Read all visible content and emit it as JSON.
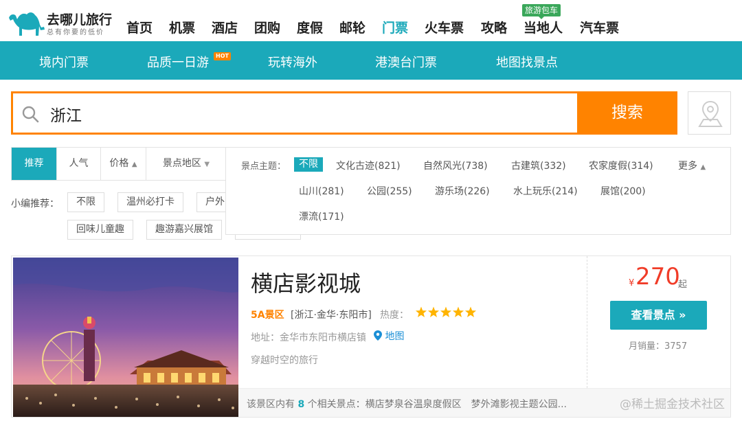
{
  "logo": {
    "name": "去哪儿旅行",
    "slogan": "总有你要的低价"
  },
  "topnav": {
    "items": [
      "首页",
      "机票",
      "酒店",
      "团购",
      "度假",
      "邮轮",
      "门票",
      "火车票",
      "攻略",
      "当地人",
      "汽车票"
    ],
    "active": "门票",
    "badge": "旅游包车"
  },
  "subnav": {
    "items": [
      "境内门票",
      "品质一日游",
      "玩转海外",
      "港澳台门票",
      "地图找景点"
    ],
    "hot_label": "HOT"
  },
  "search": {
    "value": "浙江",
    "button_label": "搜索"
  },
  "sort": {
    "recommend": "推荐",
    "popularity": "人气",
    "price": "价格",
    "price_arrow": "▲",
    "region": "景点地区",
    "region_arrow": "▼"
  },
  "themes": {
    "label": "景点主题：",
    "items": [
      "不限",
      "文化古迹(821)",
      "自然风光(738)",
      "古建筑(332)",
      "农家度假(314)",
      "山川(281)",
      "公园(255)",
      "游乐场(226)",
      "水上玩乐(214)",
      "展馆(200)",
      "漂流(171)"
    ],
    "more": "更多",
    "more_arrow": "▲"
  },
  "editor_picks": {
    "label": "小编推荐：",
    "tags": [
      "不限",
      "温州必打卡",
      "户外",
      "回味儿童趣",
      "趣游嘉兴展馆"
    ]
  },
  "result": {
    "title": "横店影视城",
    "level": "5A景区",
    "region": "[浙江·金华·东阳市]",
    "heat_label": "热度：",
    "heat_stars": 5,
    "address": "地址：金华市东阳市横店镇",
    "map_link": "地图",
    "slogan": "穿越时空的旅行",
    "price_currency": "¥",
    "price": "270",
    "price_suffix": "起",
    "view_button": "查看景点 »",
    "sales": "月销量：3757",
    "related_prefix": "该景区内有",
    "related_count": "8",
    "related_suffix": "个相关景点：横店梦泉谷温泉度假区　梦外滩影视主题公园..."
  },
  "watermark": "@稀土掘金技术社区",
  "colors": {
    "brand": "#1ba9ba",
    "accent": "#ff8300",
    "price": "#f03c28",
    "star": "#ffb400"
  }
}
